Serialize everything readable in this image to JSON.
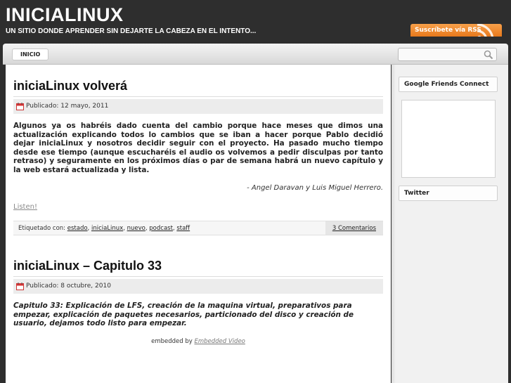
{
  "header": {
    "site_title": "INICIALINUX",
    "site_description": "UN SITIO DONDE APRENDER SIN DEJARTE LA CABEZA EN EL INTENTO...",
    "rss_label": "Suscríbete vía RSS"
  },
  "nav": {
    "items": [
      "INICIO"
    ],
    "search_placeholder": ""
  },
  "posts": [
    {
      "title": "iniciaLinux volverá",
      "date": "Publicado: 12 mayo, 2011",
      "body": "Algunos ya os habréis dado cuenta del cambio porque hace meses que dimos una actualización explicando todos lo cambios que se iban a hacer porque Pablo decidió dejar iniciaLinux y nosotros decidir seguir con el proyecto. Ha pasado mucho tiempo desde ese tiempo (aunque escucharéis el audio os volvemos a pedir disculpas por tanto retraso) y seguramente en los próximos días o par de semana habrá un nuevo capítulo y la web estará actualizada y lista.",
      "signature": "- Angel Daravan y Luis Miguel Herrero.",
      "listen": "Listen!",
      "tags_label": "Etiquetado con:",
      "tags": [
        "estado",
        "iniciaLinux",
        "nuevo",
        "podcast",
        "staff"
      ],
      "comments": "3 Comentarios"
    },
    {
      "title": "iniciaLinux – Capitulo 33",
      "date": "Publicado: 8 octubre, 2010",
      "body": "Capitulo 33: Explicación de LFS, creación de la maquina virtual, preparativos para empezar, explicación de paquetes necesarios, particionado del disco y creación de usuario, dejamos todo listo para empezar.",
      "embedded_prefix": "embedded by",
      "embedded_link": "Embedded Video"
    }
  ],
  "sidebar": {
    "widgets": [
      "Google Friends Connect",
      "Twitter"
    ]
  },
  "colors": {
    "header_bg": "#2e2e2e",
    "rss_orange": "#e8791c",
    "meta_bg": "#ececec"
  },
  "icons": [
    "rss-feed-icon",
    "search-icon",
    "calendar-icon"
  ]
}
